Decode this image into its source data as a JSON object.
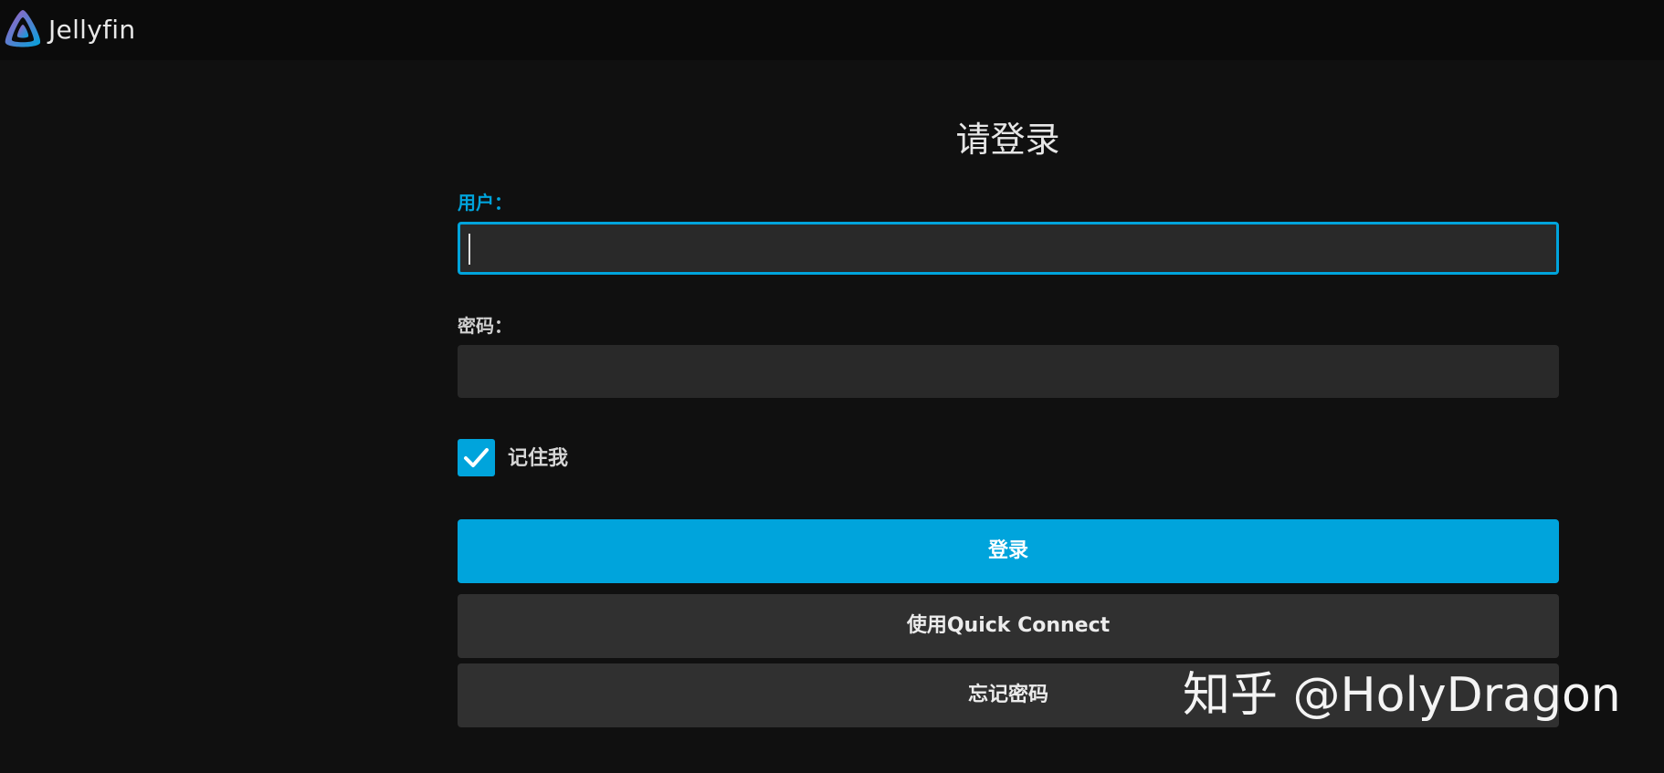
{
  "header": {
    "brand": "Jellyfin",
    "logo_icon": "jellyfin-logo-icon",
    "brand_colors": [
      "#aa5cc3",
      "#00a4dc"
    ]
  },
  "login": {
    "title": "请登录",
    "username_label": "用户：",
    "username_value": "",
    "password_label": "密码：",
    "password_value": "",
    "remember_label": "记住我",
    "remember_checked": true,
    "login_button": "登录",
    "quick_connect_button": "使用Quick Connect",
    "forgot_password_button": "忘记密码"
  },
  "watermark": "知乎 @HolyDragon",
  "colors": {
    "accent": "#00a4dc",
    "background": "#101010",
    "field": "#292929",
    "secondary_button": "#303030"
  }
}
